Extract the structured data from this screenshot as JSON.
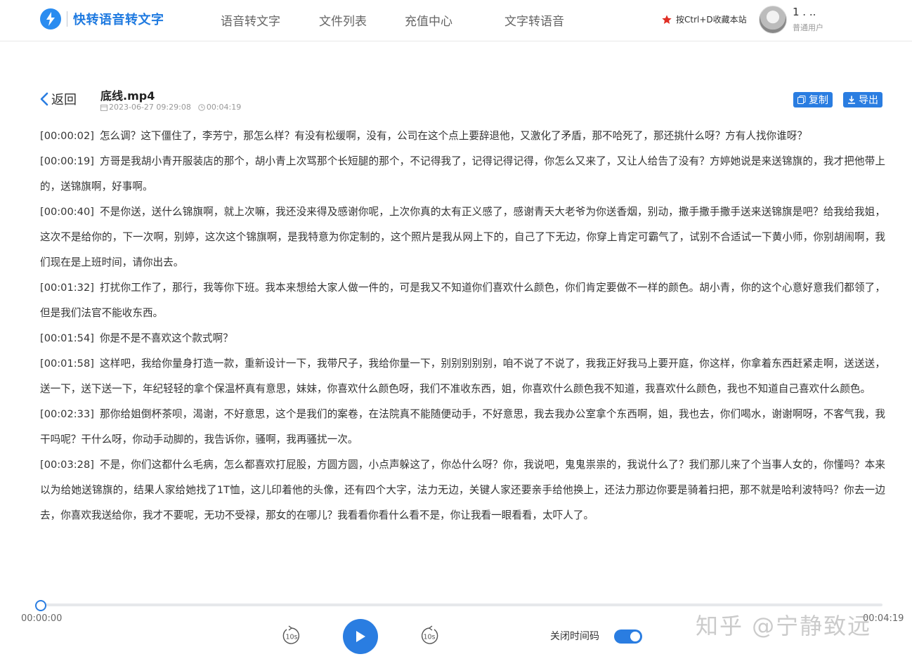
{
  "header": {
    "logo_text": "快转语音转文字",
    "nav": [
      "语音转文字",
      "文件列表",
      "充值中心",
      "文字转语音"
    ],
    "bookmark_hint": "按Ctrl+D收藏本站",
    "user_name": "1 . ..",
    "user_role": "普通用户"
  },
  "file": {
    "back_label": "返回",
    "title": "底线.mp4",
    "date": "2023-06-27 09:29:08",
    "duration": "00:04:19",
    "copy_label": "复制",
    "export_label": "导出"
  },
  "transcript": [
    {
      "time": "[00:00:02]",
      "text": "怎么调？这下僵住了，李芳宁，那怎么样？有没有松缓啊，没有，公司在这个点上要辞退他，又激化了矛盾，那不哈死了，那还挑什么呀？方有人找你谁呀？"
    },
    {
      "time": "[00:00:19]",
      "text": "方哥是我胡小青开服装店的那个，胡小青上次骂那个长短腿的那个，不记得我了，记得记得记得，你怎么又来了，又让人给告了没有？方婷她说是来送锦旗的，我才把他带上的，送锦旗啊，好事啊。"
    },
    {
      "time": "[00:00:40]",
      "text": "不是你送，送什么锦旗啊，就上次嘛，我还没来得及感谢你呢，上次你真的太有正义感了，感谢青天大老爷为你送香烟，别动，撒手撒手撒手送来送锦旗是吧？给我给我姐，这次不是给你的，下一次啊，别婷，这次这个锦旗啊，是我特意为你定制的，这个照片是我从网上下的，自己了下无边，你穿上肯定可霸气了，试别不合适试一下黄小师，你别胡闹啊，我们现在是上班时间，请你出去。"
    },
    {
      "time": "[00:01:32]",
      "text": "打扰你工作了，那行，我等你下班。我本来想给大家人做一件的，可是我又不知道你们喜欢什么颜色，你们肯定要做不一样的颜色。胡小青，你的这个心意好意我们都领了，但是我们法官不能收东西。"
    },
    {
      "time": "[00:01:54]",
      "text": "你是不是不喜欢这个款式啊？"
    },
    {
      "time": "[00:01:58]",
      "text": "这样吧，我给你量身打造一款，重新设计一下，我带尺子，我给你量一下，别别别别别，咱不说了不说了，我我正好我马上要开庭，你这样，你拿着东西赶紧走啊，送送送，送一下，送下送一下，年纪轻轻的拿个保温杯真有意思，妹妹，你喜欢什么颜色呀，我们不准收东西，姐，你喜欢什么颜色我不知道，我喜欢什么颜色，我也不知道自己喜欢什么颜色。"
    },
    {
      "time": "[00:02:33]",
      "text": "那你给姐倒杯茶呗，渴谢，不好意思，这个是我们的案卷，在法院真不能随便动手，不好意思，我去我办公室拿个东西啊，姐，我也去，你们喝水，谢谢啊呀，不客气我，我干吗呢？干什么呀，你动手动脚的，我告诉你，骚啊，我再骚扰一次。"
    },
    {
      "time": "[00:03:28]",
      "text": "不是，你们这都什么毛病，怎么都喜欢打屁股，方圆方圆，小点声躲这了，你怂什么呀？你，我说吧，鬼鬼祟祟的，我说什么了？我们那儿来了个当事人女的，你懂吗？本来以为给她送锦旗的，结果人家给她找了1T恤，这儿印着他的头像，还有四个大字，法力无边，关键人家还要亲手给他换上，还法力那边你要是骑着扫把，那不就是哈利波特吗？你去一边去，你喜欢我送给你，我才不要呢，无功不受禄，那女的在哪儿？我看看你看什么看不是，你让我看一眼看看，太吓人了。"
    }
  ],
  "player": {
    "current_time": "00:00:00",
    "total_time": "00:04:19",
    "progress": 0,
    "skip_back_label": "10s",
    "skip_forward_label": "10s",
    "toggle_label": "关闭时间码",
    "toggle_on": true
  },
  "watermark": "知乎 @宁静致远"
}
